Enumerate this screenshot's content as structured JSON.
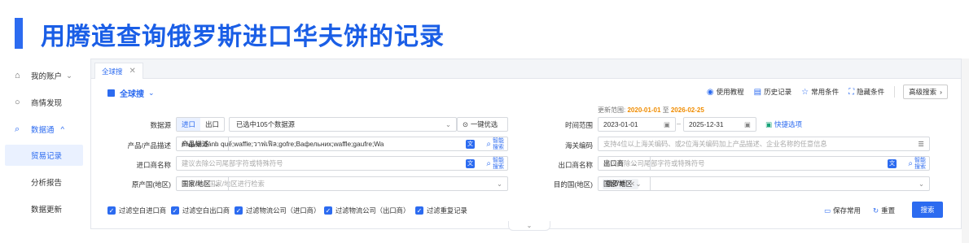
{
  "header": {
    "title": "用腾道查询俄罗斯进口华夫饼的记录"
  },
  "sidebar": {
    "account": "我的账户",
    "discovery": "商情发现",
    "datatong": "数据通",
    "trade_records": "贸易记录",
    "analysis": "分析报告",
    "data_update": "数据更新"
  },
  "tabs": [
    {
      "label": "全球搜"
    }
  ],
  "scope": {
    "label": "全球搜"
  },
  "toolbar": {
    "tutorial": "使用教程",
    "history": "历史记录",
    "common": "常用条件",
    "hide": "隐藏条件",
    "advanced": "高级搜索"
  },
  "update_range": {
    "prefix": "更新范围:",
    "start": "2020-01-01",
    "mid": "至",
    "end": "2026-02-25"
  },
  "form": {
    "datasource_label": "数据源",
    "import": "进口",
    "export": "出口",
    "datasource_value": "已选中105个数据源",
    "one_click": "一键优选",
    "product_label": "产品/产品描述",
    "product_type": "产品描述",
    "product_value": "вафля;bánh quế;waffle;วาฟเฟิล;gofre;Вафельних;waffle;gaufre;Wa",
    "smart_search_1": "智能",
    "smart_search_2": "搜索",
    "importer_label": "进口商名称",
    "importer_placeholder": "建议去除公司尾部字符或特殊符号",
    "origin_label": "原产国(地区)",
    "origin_type": "国家/地区",
    "origin_placeholder": "支持输入国家/地区进行检索",
    "time_label": "时间范围",
    "time_start": "2023-01-01",
    "time_end": "2025-12-31",
    "quick_select": "快捷选项",
    "hscode_label": "海关编码",
    "hscode_placeholder": "支持4位以上海关编码、或2位海关编码加上产品描述、企业名称的任意信息",
    "exporter_label": "出口商名称",
    "exporter_type": "出口商",
    "exporter_placeholder": "建议去除公司尾部字符或特殊符号",
    "dest_label": "目的国(地区)",
    "dest_type": "国家/地区",
    "dest_tag": "俄罗斯"
  },
  "filters": [
    "过滤空白进口商",
    "过滤空白出口商",
    "过滤物流公司（进口商）",
    "过滤物流公司（出口商）",
    "过滤重复记录"
  ],
  "actions": {
    "save": "保存常用",
    "reset": "重置",
    "search": "搜索"
  },
  "colors": {
    "accent": "#2c6bf0",
    "date": "#f08c00"
  }
}
